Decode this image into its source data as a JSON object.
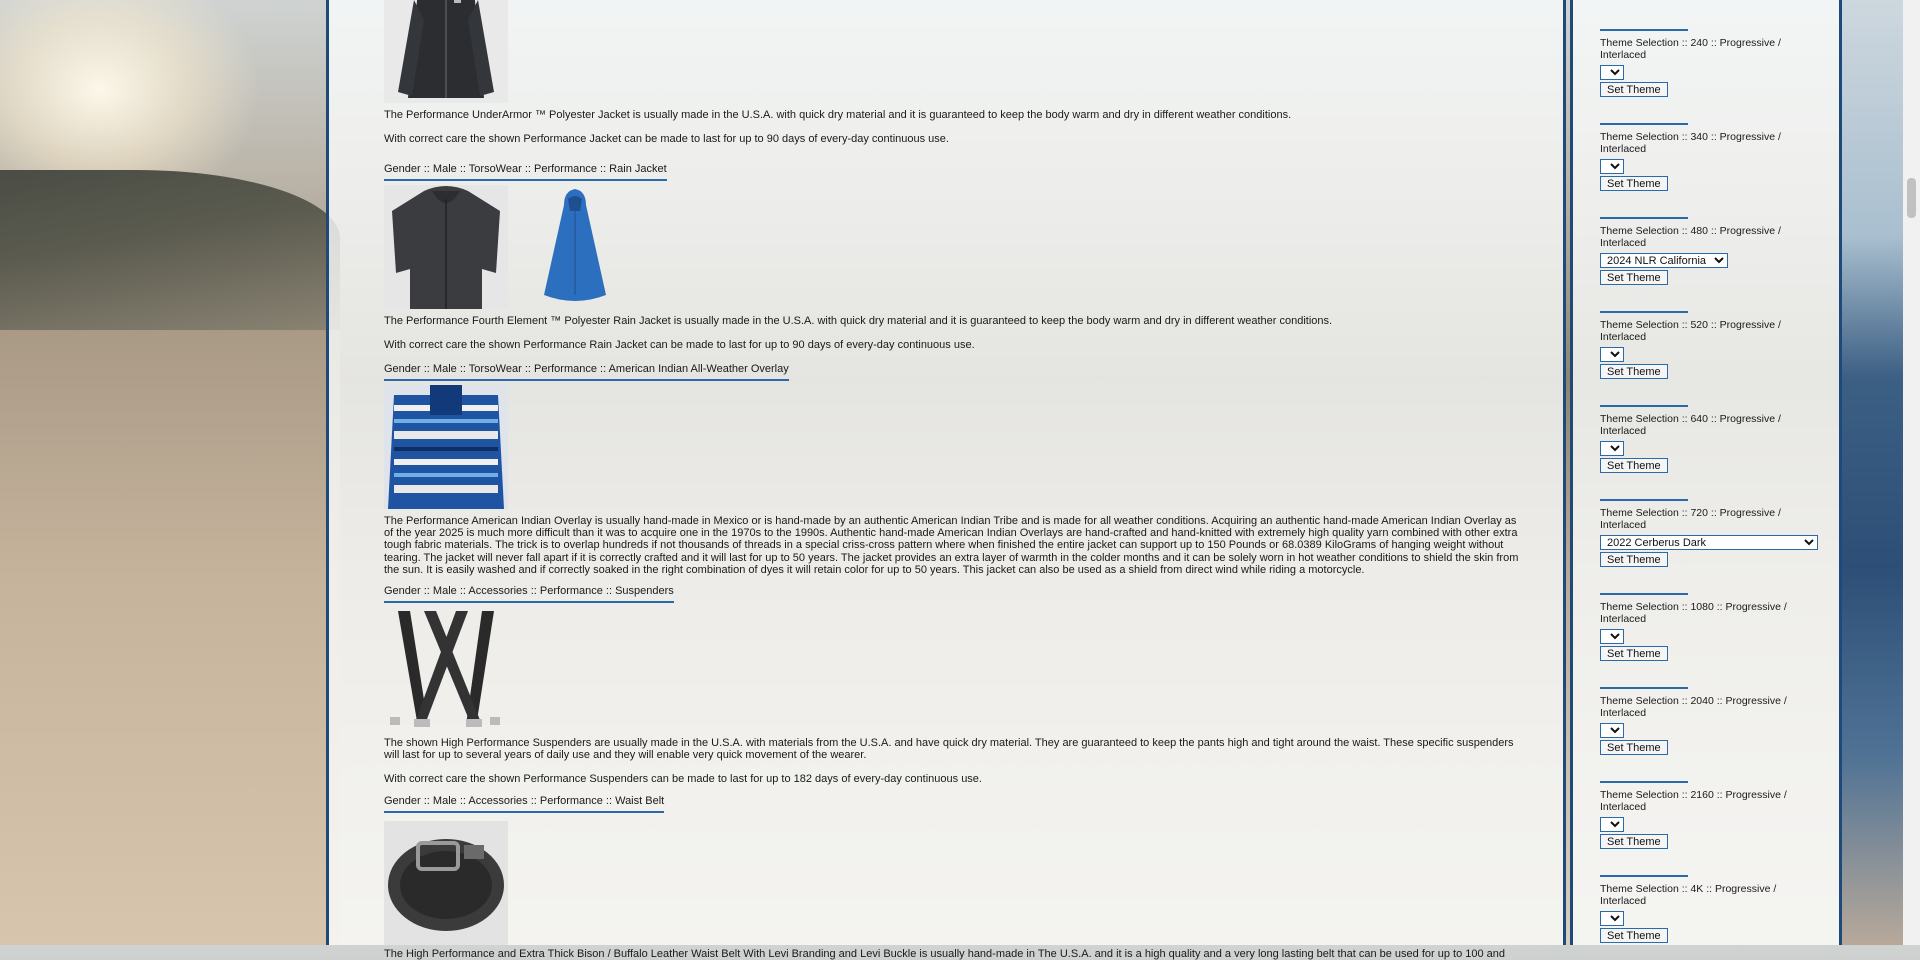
{
  "products": [
    {
      "category": "",
      "images": [
        "jacket-icon"
      ],
      "desc1": "The Performance UnderArmor ™ Polyester Jacket is usually made in the U.S.A. with quick dry material and it is guaranteed to keep the body warm and dry in different weather conditions.",
      "desc2": "With correct care the shown Performance Jacket can be made to last for up to 90 days of every-day continuous use."
    },
    {
      "category": "Gender :: Male :: TorsoWear :: Performance :: Rain Jacket",
      "images": [
        "rain-jacket-icon",
        "poncho-icon"
      ],
      "desc1": "The Performance Fourth Element ™ Polyester Rain Jacket is usually made in the U.S.A. with quick dry material and it is guaranteed to keep the body warm and dry in different weather conditions.",
      "desc2": "With correct care the shown Performance Rain Jacket can be made to last for up to 90 days of every-day continuous use."
    },
    {
      "category": "Gender :: Male :: TorsoWear :: Performance :: American Indian All-Weather Overlay",
      "images": [
        "overlay-icon"
      ],
      "desc1": "The Performance American Indian Overlay is usually hand-made in Mexico or is hand-made by an authentic American Indian Tribe and is made for all weather conditions. Acquiring an authentic hand-made American Indian Overlay as of the year 2025 is much more difficult than it was to acquire one in the 1970s to the 1990s. Authentic hand-made American Indian Overlays are hand-crafted and hand-knitted with extremely high quality yarn combined with other extra tough fabric materials. The trick is to overlap hundreds if not thousands of threads in a special criss-cross pattern where when finished the entire jacket can support up to 150 Pounds or 68.0389 KiloGrams of hanging weight without tearing. The jacket will never fall apart if it is correctly crafted and it will last for up to 50 years. The jacket provides an extra layer of warmth in the colder months and it can be solely worn in hot weather conditions to shield the skin from the sun. It is easily washed and if correctly soaked in the right combination of dyes it will retain color for up to 50 years. This jacket can also be used as a shield from direct wind while riding a motorcycle.",
      "desc2": ""
    },
    {
      "category": "Gender :: Male :: Accessories :: Performance :: Suspenders",
      "images": [
        "suspenders-icon"
      ],
      "desc1": "The shown High Performance Suspenders are usually made in the U.S.A. with materials from the U.S.A. and have quick dry material. They are guaranteed to keep the pants high and tight around the waist. These specific suspenders will last for up to several years of daily use and they will enable very quick movement of the wearer.",
      "desc2": "With correct care the shown Performance Suspenders can be made to last for up to 182 days of every-day continuous use."
    },
    {
      "category": "Gender :: Male :: Accessories :: Performance :: Waist Belt",
      "images": [
        "belt-icon"
      ],
      "desc1": "The High Performance and Extra Thick Bison / Buffalo Leather Waist Belt With Levi Branding and Levi Buckle is usually hand-made in The U.S.A. and it is a high quality and a very long lasting belt that can be used for up to 100 and",
      "desc2": ""
    }
  ],
  "sidebar": {
    "button_label": "Set Theme",
    "themes": [
      {
        "label": "",
        "selected": ""
      },
      {
        "label": "Theme Selection :: 240 :: Progressive / Interlaced",
        "selected": ""
      },
      {
        "label": "Theme Selection :: 340 :: Progressive / Interlaced",
        "selected": ""
      },
      {
        "label": "Theme Selection :: 480 :: Progressive / Interlaced",
        "selected": "2024 NLR California"
      },
      {
        "label": "Theme Selection :: 520 :: Progressive / Interlaced",
        "selected": ""
      },
      {
        "label": "Theme Selection :: 640 :: Progressive / Interlaced",
        "selected": ""
      },
      {
        "label": "Theme Selection :: 720 :: Progressive / Interlaced",
        "selected": "2022 Cerberus Dark"
      },
      {
        "label": "Theme Selection :: 1080 :: Progressive / Interlaced",
        "selected": ""
      },
      {
        "label": "Theme Selection :: 2040 :: Progressive / Interlaced",
        "selected": ""
      },
      {
        "label": "Theme Selection :: 2160 :: Progressive / Interlaced",
        "selected": ""
      },
      {
        "label": "Theme Selection :: 4K :: Progressive / Interlaced",
        "selected": ""
      }
    ]
  },
  "colors": {
    "accent": "#2a6aa8",
    "border": "#1e4a7a"
  }
}
